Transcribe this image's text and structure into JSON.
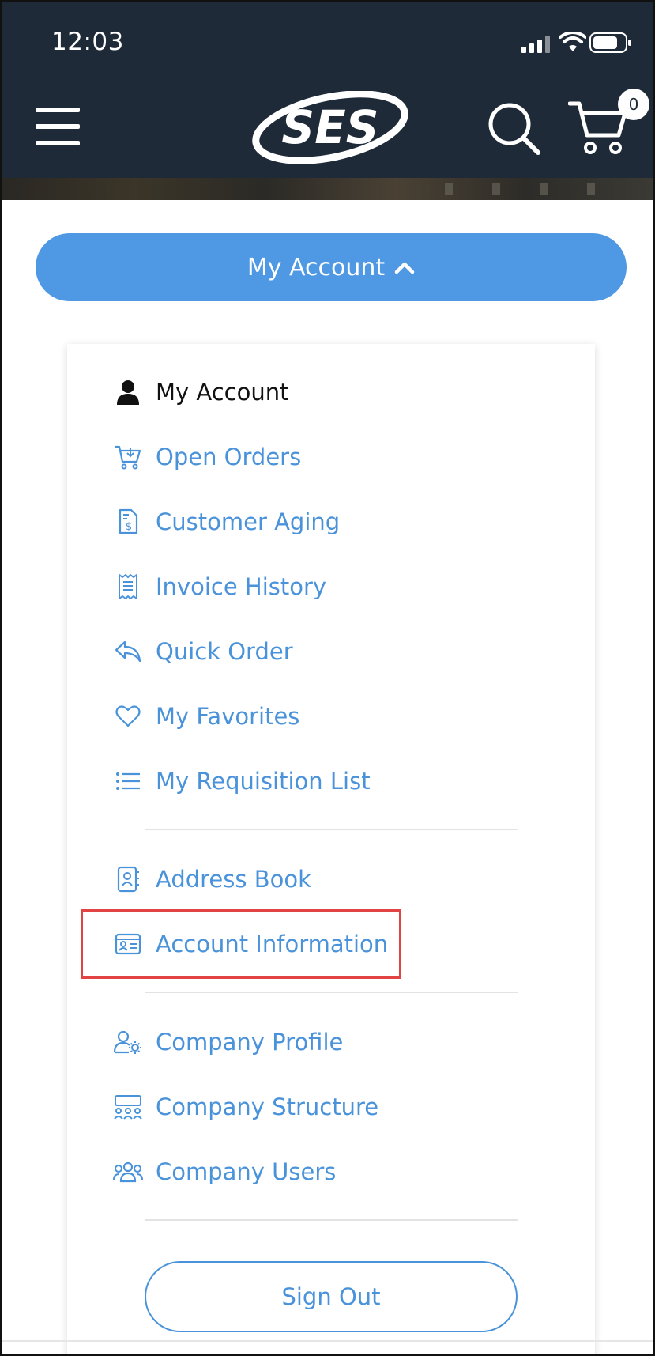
{
  "status_bar": {
    "time": "12:03"
  },
  "header": {
    "logo_text": "SES",
    "cart_count": "0"
  },
  "account_toggle": {
    "label": "My Account"
  },
  "menu": {
    "items": [
      {
        "label": "My Account",
        "icon": "user-icon",
        "active": true
      },
      {
        "label": "Open Orders",
        "icon": "cart-download-icon"
      },
      {
        "label": "Customer Aging",
        "icon": "invoice-dollar-icon"
      },
      {
        "label": "Invoice History",
        "icon": "receipt-icon"
      },
      {
        "label": "Quick Order",
        "icon": "reply-arrow-icon"
      },
      {
        "label": "My Favorites",
        "icon": "heart-icon"
      },
      {
        "label": "My Requisition List",
        "icon": "list-icon"
      },
      {
        "label": "Address Book",
        "icon": "contact-book-icon"
      },
      {
        "label": "Account Information",
        "icon": "id-card-icon",
        "highlighted": true
      },
      {
        "label": "Company Profile",
        "icon": "user-gear-icon"
      },
      {
        "label": "Company Structure",
        "icon": "org-structure-icon"
      },
      {
        "label": "Company Users",
        "icon": "users-group-icon"
      }
    ],
    "sign_out_label": "Sign Out"
  },
  "colors": {
    "header_bg": "#1f2a38",
    "accent": "#4f98e4",
    "link": "#4a93da",
    "highlight": "#e24444"
  }
}
